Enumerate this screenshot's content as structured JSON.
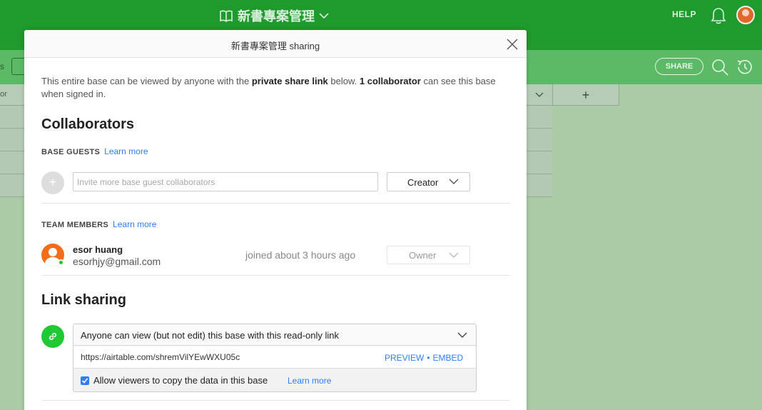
{
  "app": {
    "base_title": "新書專案管理",
    "help_label": "HELP",
    "view_stub": "s",
    "share_label": "SHARE",
    "column_stub": "or",
    "add_column": "+"
  },
  "modal": {
    "title": "新書專案管理 sharing",
    "intro": {
      "part1": "This entire base can be viewed by anyone with the ",
      "bold1": "private share link",
      "part2": " below. ",
      "bold2": "1 collaborator",
      "part3": " can see this base when signed in."
    },
    "collaborators": {
      "heading": "Collaborators",
      "base_guests_label": "BASE GUESTS",
      "learn_more": "Learn more",
      "add_icon": "+",
      "invite_placeholder": "Invite more base guest collaborators",
      "role_value": "Creator",
      "team_members_label": "TEAM MEMBERS",
      "team_learn_more": "Learn more",
      "members": [
        {
          "name": "esor huang",
          "email": "esorhjy@gmail.com",
          "joined": "joined about 3 hours ago",
          "role": "Owner"
        }
      ]
    },
    "link_sharing": {
      "heading": "Link sharing",
      "mode": "Anyone can view (but not edit) this base with this read-only link",
      "url": "https://airtable.com/shremVilYEwWXU05c",
      "preview": "PREVIEW",
      "separator": "•",
      "embed": "EMBED",
      "allow_copy_label": "Allow viewers to copy the data in this base",
      "allow_copy_checked": true,
      "learn_more": "Learn more"
    }
  },
  "colors": {
    "brand_green": "#1f9a2d",
    "accent_blue": "#2d7ff9",
    "link_green": "#20c933"
  }
}
